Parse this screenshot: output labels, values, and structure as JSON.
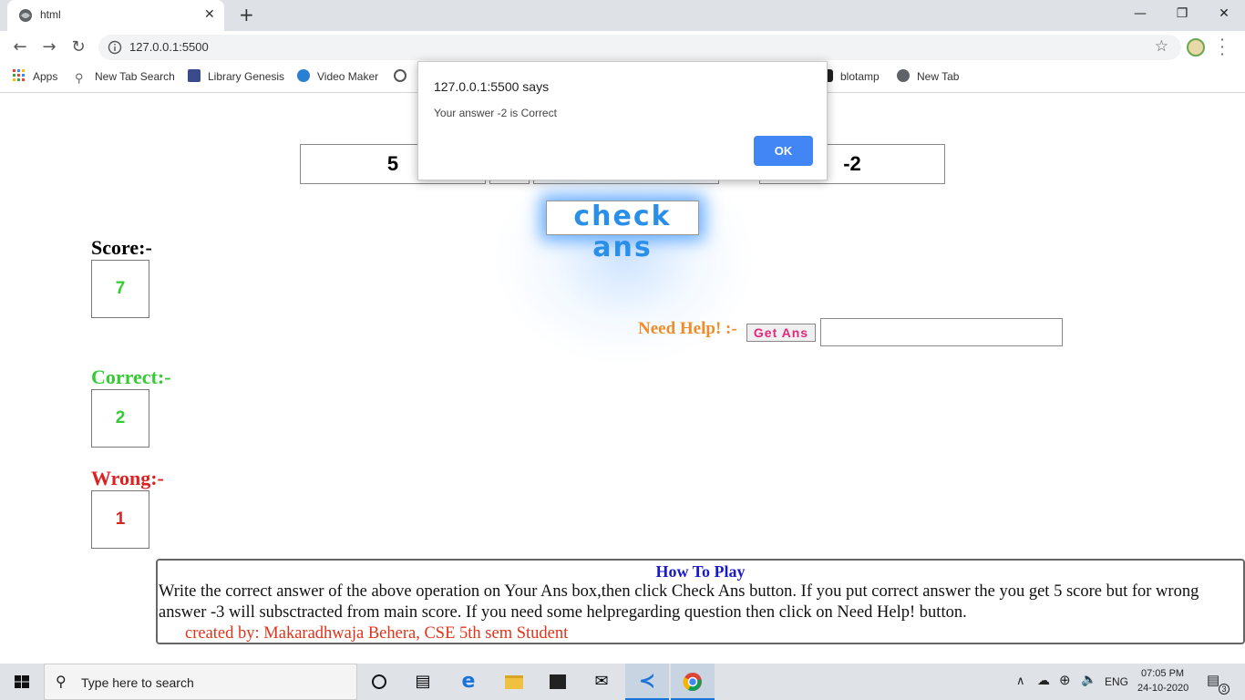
{
  "browser": {
    "tab_title": "html",
    "url": "127.0.0.1:5500",
    "bookmarks": [
      "Apps",
      "New Tab Search",
      "Library Genesis",
      "Video Maker",
      "blotamp",
      "New Tab"
    ]
  },
  "game": {
    "operand1": "5",
    "answer_shown": "-2",
    "check_button": "check ans",
    "score_label": "Score:-",
    "score_value": "7",
    "correct_label": "Correct:-",
    "correct_value": "2",
    "wrong_label": "Wrong:-",
    "wrong_value": "1",
    "help_label": "Need Help! :-",
    "get_ans_button": "Get Ans",
    "help_input_value": "",
    "colors": {
      "score": "#000000",
      "correct": "#33cc33",
      "wrong": "#dd2222",
      "help": "#f08c28",
      "check_text": "#2a8fe8",
      "get_ans_text": "#e2287a"
    }
  },
  "howto": {
    "title": "How To Play",
    "text": "Write the correct answer of the above operation on Your Ans box,then click Check Ans button. If you put correct answer the you get 5 score but for wrong answer -3 will subsctracted from main score. If you need some helpregarding question then click on Need Help! button.",
    "credit": "created by: Makaradhwaja Behera, CSE 5th sem Student"
  },
  "alert": {
    "title": "127.0.0.1:5500 says",
    "message": "Your answer -2 is Correct",
    "ok": "OK"
  },
  "taskbar": {
    "search_placeholder": "Type here to search",
    "language": "ENG",
    "time": "07:05 PM",
    "date": "24-10-2020",
    "notifications": "3"
  }
}
